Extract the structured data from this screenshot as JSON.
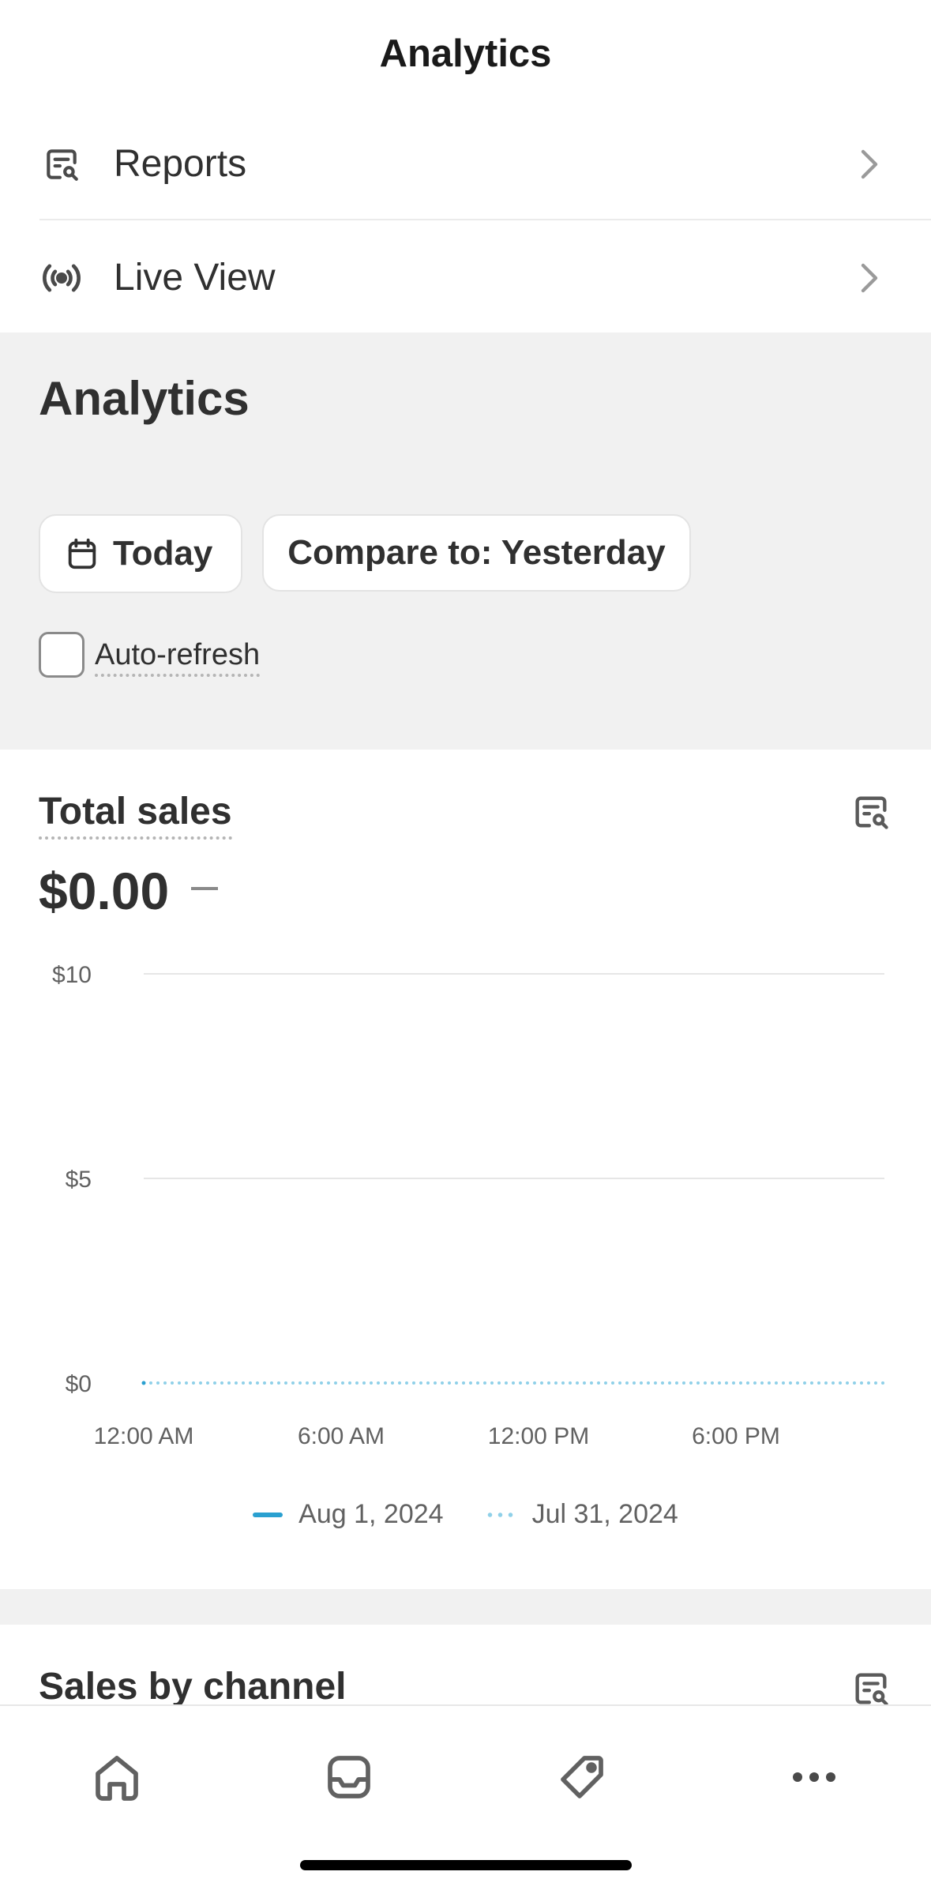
{
  "header": {
    "title": "Analytics"
  },
  "nav": {
    "items": [
      {
        "label": "Reports",
        "icon": "report-search-icon"
      },
      {
        "label": "Live View",
        "icon": "broadcast-icon"
      }
    ]
  },
  "section": {
    "title": "Analytics"
  },
  "filters": {
    "date_label": "Today",
    "compare_label": "Compare to: Yesterday",
    "auto_refresh_label": "Auto-refresh",
    "auto_refresh_checked": false
  },
  "total_sales": {
    "title": "Total sales",
    "value": "$0.00",
    "change": "–"
  },
  "chart_data": {
    "type": "line",
    "title": "Total sales",
    "x_ticks": [
      "12:00 AM",
      "6:00 AM",
      "12:00 PM",
      "6:00 PM"
    ],
    "y_ticks": [
      "$10",
      "$5",
      "$0"
    ],
    "ylim": [
      0,
      10
    ],
    "grid": true,
    "series": [
      {
        "name": "Aug 1, 2024",
        "style": "solid",
        "color": "#2aa0d0",
        "x": [
          "12:00 AM"
        ],
        "values": [
          0
        ]
      },
      {
        "name": "Jul 31, 2024",
        "style": "dotted",
        "color": "#8fd0e8",
        "x": [
          "12:00 AM",
          "6:00 AM",
          "12:00 PM",
          "6:00 PM"
        ],
        "values": [
          0,
          0,
          0,
          0
        ]
      }
    ],
    "legend": "bottom-center"
  },
  "sales_by_channel": {
    "title": "Sales by channel"
  },
  "tabbar": {
    "items": [
      {
        "icon": "home-icon"
      },
      {
        "icon": "inbox-icon"
      },
      {
        "icon": "tag-icon"
      },
      {
        "icon": "more-icon"
      }
    ]
  }
}
